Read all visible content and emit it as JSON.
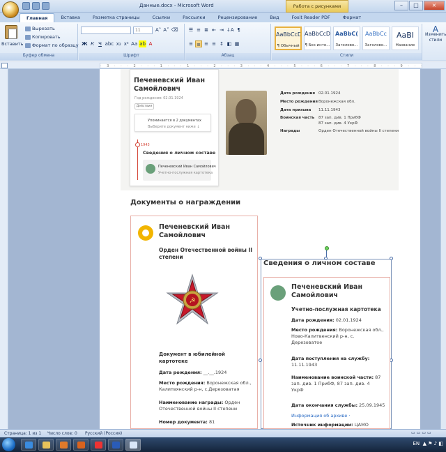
{
  "window": {
    "title": "Данные.docx - Microsoft Word",
    "context_tab": "Работа с рисунками"
  },
  "tabs": [
    "Главная",
    "Вставка",
    "Разметка страницы",
    "Ссылки",
    "Рассылки",
    "Рецензирование",
    "Вид",
    "Foxit Reader PDF",
    "Формат"
  ],
  "ribbon": {
    "paste": "Вставить",
    "cut": "Вырезать",
    "copy": "Копировать",
    "format_painter": "Формат по образцу",
    "group_clipboard": "Буфер обмена",
    "font_size": "11",
    "group_font": "Шрифт",
    "group_paragraph": "Абзац",
    "group_styles": "Стили",
    "change_styles": "Изменить стили",
    "styles": [
      {
        "sample": "AaBbCcDc",
        "name": "¶ Обычный"
      },
      {
        "sample": "AaBbCcDc",
        "name": "¶ Без инте..."
      },
      {
        "sample": "AaBbC(",
        "name": "Заголово..."
      },
      {
        "sample": "AaBbCc",
        "name": "Заголово..."
      },
      {
        "sample": "AaBI",
        "name": "Название"
      }
    ]
  },
  "ruler_text": "· 3 · · · 2 · · · 1 · · · 1 · · · 2 · · · 3 · · · 4 · · · 5 · · · 6 · · · 7 · · · 8 · · · 9 · · · 10 · · · 11 · · · 12 · · · 13 · · · 14 · · · 15 · · · 16 · · · 17 ·",
  "screenshot": {
    "name_line1": "Печеневский Иван",
    "name_line2": "Самойлович",
    "birth_small": "Год рождения: 02.01.1924",
    "details_btn": "Действия",
    "mention_line1": "Упоминается в 2 документах",
    "mention_line2": "Выберите документ ниже ↓",
    "year": "1943",
    "section": "Сведения о личном составе",
    "doc_name": "Печеневский Иван Самойлович",
    "doc_type": "Учетно-послужная картотека",
    "info": [
      {
        "k": "Дата рождения",
        "v": "02.01.1924"
      },
      {
        "k": "Место рождения",
        "v": "Воронежская обл."
      },
      {
        "k": "Дата призыва",
        "v": "11.11.1943"
      },
      {
        "k": "Воинская часть",
        "v": "87 зап. див. 1 ПрибФ"
      },
      {
        "k": "",
        "v": "87 зап. див. 4 УкрФ"
      },
      {
        "k": "Награды",
        "v": "Орден Отечественной войны II степени"
      }
    ]
  },
  "award_heading": "Документы о награждении",
  "award": {
    "name_line1": "Печеневский Иван",
    "name_line2": "Самойлович",
    "order_line1": "Орден Отечественной войны II",
    "order_line2": "степени",
    "doc_line1": "Документ в юбилейной",
    "doc_line2": "картотеке",
    "birth_k": "Дата рождения:",
    "birth_v": " __.__.1924",
    "place_k": "Место рождения:",
    "place_v1": " Воронежская обл.,",
    "place_v2": "Калитвянский р-н, с.Дерезоватая",
    "award_k": "Наименование награды:",
    "award_v1": " Орден",
    "award_v2": "Отечественной войны II степени",
    "docnum_k": "Номер документа:",
    "docnum_v": " 81"
  },
  "textbox": {
    "title": "Сведения о личном составе",
    "name_line1": "Печеневский Иван",
    "name_line2": "Самойлович",
    "type": "Учетно-послужная картотека",
    "birth_k": "Дата рождения:",
    "birth_v": " 02.01.1924",
    "place_k": "Место рождения:",
    "place_v1": " Воронежская обл.,",
    "place_v2": "Ново-Калитвенский р-н, с.",
    "place_v3": "Дерезоватое",
    "enter_k": "Дата поступления на службу:",
    "enter_v": "11.11.1943",
    "unit_k": "Наименование воинской части:",
    "unit_v1": " 87",
    "unit_v2": "зап. див. 1 ПрибФ, 87 зап. див. 4",
    "unit_v3": "УкрФ",
    "end_k": "Дата окончания службы:",
    "end_v": " 25.09.1945",
    "archive_link": "Информация об архиве ·",
    "source_k": "Источник информации:",
    "source_v": " ЦАМО"
  },
  "status": {
    "page": "Страница: 1 из 1",
    "words": "Число слов: 0",
    "lang": "Русский (Россия)"
  },
  "taskbar": {
    "lang": "EN"
  }
}
